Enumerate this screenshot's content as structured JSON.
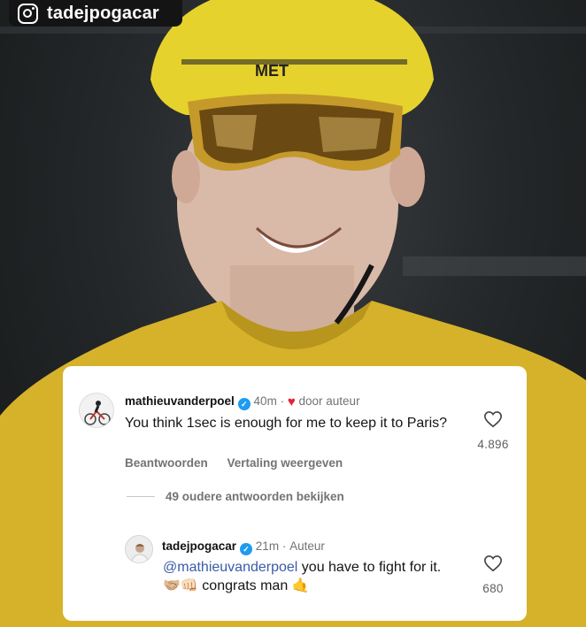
{
  "account": {
    "handle": "tadejpogacar",
    "icon": "instagram-icon"
  },
  "comments": [
    {
      "username": "mathieuvanderpoel",
      "verified": true,
      "time": "40m",
      "separator": "·",
      "liked_by_author_label": "door auteur",
      "text": "You think 1sec is enough for me to keep it to Paris?",
      "likes": "4.896",
      "reply_label": "Beantwoorden",
      "translate_label": "Vertaling weergeven"
    }
  ],
  "thread": {
    "older_replies_label": "49 oudere antwoorden bekijken"
  },
  "reply": {
    "username": "tadejpogacar",
    "verified": true,
    "time": "21m",
    "separator": "·",
    "author_label": "Auteur",
    "mention": "@mathieuvanderpoel",
    "text": " you have to fight for it. 🤝🏼👊🏻 congrats man 🤙",
    "likes": "680"
  },
  "colors": {
    "verified": "#1e9bf0",
    "mention": "#3a5aa8",
    "liked_heart": "#e0243b"
  }
}
